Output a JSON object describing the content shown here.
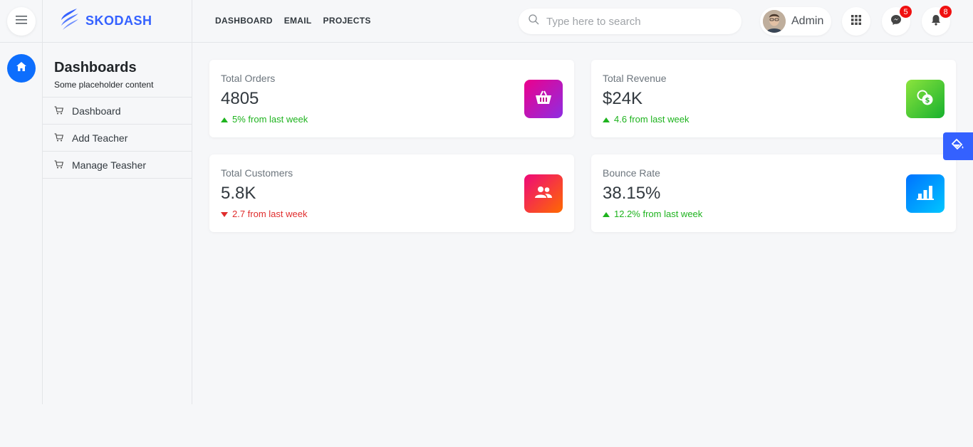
{
  "brand": {
    "name": "SKODASH",
    "color": "#3461ff"
  },
  "sidebar": {
    "title": "Dashboards",
    "subtitle": "Some placeholder content",
    "items": [
      {
        "label": "Dashboard",
        "icon": "cart-icon"
      },
      {
        "label": "Add Teacher",
        "icon": "cart-icon"
      },
      {
        "label": "Manage Teasher",
        "icon": "cart-icon"
      }
    ]
  },
  "topnav": {
    "items": [
      "DASHBOARD",
      "EMAIL",
      "PROJECTS"
    ]
  },
  "search": {
    "placeholder": "Type here to search",
    "value": ""
  },
  "user": {
    "name": "Admin"
  },
  "badges": {
    "messages": "5",
    "notifications": "8"
  },
  "cards": [
    {
      "label": "Total Orders",
      "value": "4805",
      "trend": "5% from last week",
      "direction": "up",
      "icon": "basket-icon",
      "gradient": [
        "#ec008c",
        "#8e2de2"
      ]
    },
    {
      "label": "Total Revenue",
      "value": "$24K",
      "trend": "4.6 from last week",
      "direction": "up",
      "icon": "money-icon",
      "gradient": [
        "#8ce43d",
        "#17b12e"
      ]
    },
    {
      "label": "Total Customers",
      "value": "5.8K",
      "trend": "2.7 from last week",
      "direction": "down",
      "icon": "users-icon",
      "gradient": [
        "#ee0979",
        "#ff6a00"
      ]
    },
    {
      "label": "Bounce Rate",
      "value": "38.15%",
      "trend": "12.2% from last week",
      "direction": "up",
      "icon": "bar-chart-icon",
      "gradient": [
        "#0072ff",
        "#00c6ff"
      ]
    }
  ],
  "colors": {
    "up": "#1eb31e",
    "down": "#e02d2d",
    "accent": "#0d6efd"
  }
}
